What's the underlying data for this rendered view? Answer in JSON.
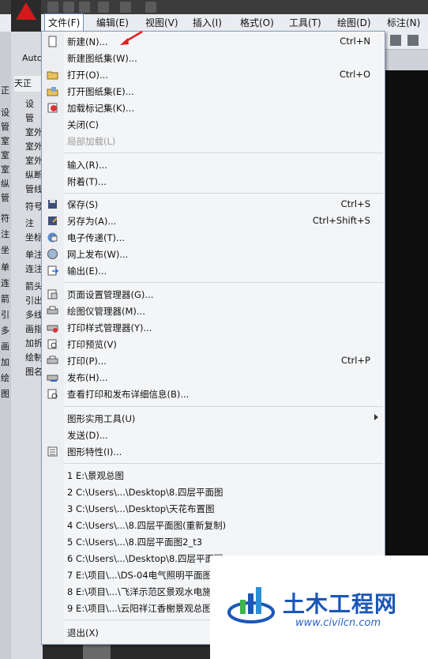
{
  "menubar": {
    "items": [
      {
        "label": "文件(F)"
      },
      {
        "label": "编辑(E)"
      },
      {
        "label": "视图(V)"
      },
      {
        "label": "插入(I)"
      },
      {
        "label": "格式(O)"
      },
      {
        "label": "工具(T)"
      },
      {
        "label": "绘图(D)"
      },
      {
        "label": "标注(N)"
      }
    ]
  },
  "left_panel": {
    "tab_label": "天正",
    "items": [
      "设",
      "管",
      "室外",
      "室外",
      "室外",
      "纵断",
      "管线",
      "符号",
      "注",
      "坐标",
      "单注",
      "连注",
      "箭头",
      "引出",
      "多线",
      "画指",
      "加折",
      "绘制",
      "图名"
    ],
    "strip_chars": [
      "正",
      "设",
      "管",
      "室",
      "室",
      "室",
      "纵",
      "管",
      "符",
      "注",
      "坐",
      "单",
      "连",
      "箭",
      "引",
      "多",
      "画",
      "加",
      "绘",
      "图"
    ]
  },
  "toolbar_right": {
    "label": "Autc"
  },
  "file_menu": {
    "items": [
      {
        "label": "新建(N)...",
        "shortcut": "Ctrl+N",
        "icon": "new-file-icon"
      },
      {
        "label": "新建图纸集(W)...",
        "shortcut": "",
        "icon": ""
      },
      {
        "label": "打开(O)...",
        "shortcut": "Ctrl+O",
        "icon": "open-folder-icon"
      },
      {
        "label": "打开图纸集(E)...",
        "shortcut": "",
        "icon": "open-sheetset-icon"
      },
      {
        "label": "加载标记集(K)...",
        "shortcut": "",
        "icon": "markup-icon"
      },
      {
        "label": "关闭(C)",
        "shortcut": "",
        "icon": ""
      },
      {
        "label": "局部加载(L)",
        "shortcut": "",
        "icon": "",
        "disabled": true
      },
      {
        "label": "输入(R)...",
        "shortcut": "",
        "icon": ""
      },
      {
        "label": "附着(T)...",
        "shortcut": "",
        "icon": ""
      },
      {
        "label": "保存(S)",
        "shortcut": "Ctrl+S",
        "icon": "save-icon"
      },
      {
        "label": "另存为(A)...",
        "shortcut": "Ctrl+Shift+S",
        "icon": "save-as-icon"
      },
      {
        "label": "电子传递(T)...",
        "shortcut": "",
        "icon": "etransmit-icon"
      },
      {
        "label": "网上发布(W)...",
        "shortcut": "",
        "icon": "publish-web-icon"
      },
      {
        "label": "输出(E)...",
        "shortcut": "",
        "icon": "export-icon"
      },
      {
        "label": "页面设置管理器(G)...",
        "shortcut": "",
        "icon": "page-setup-icon"
      },
      {
        "label": "绘图仪管理器(M)...",
        "shortcut": "",
        "icon": "plotter-icon"
      },
      {
        "label": "打印样式管理器(Y)...",
        "shortcut": "",
        "icon": "plot-style-icon"
      },
      {
        "label": "打印预览(V)",
        "shortcut": "",
        "icon": "preview-icon"
      },
      {
        "label": "打印(P)...",
        "shortcut": "Ctrl+P",
        "icon": "print-icon"
      },
      {
        "label": "发布(H)...",
        "shortcut": "",
        "icon": "publish-icon"
      },
      {
        "label": "查看打印和发布详细信息(B)...",
        "shortcut": "",
        "icon": "details-icon"
      },
      {
        "label": "图形实用工具(U)",
        "shortcut": "",
        "icon": "",
        "submenu": true
      },
      {
        "label": "发送(D)...",
        "shortcut": "",
        "icon": ""
      },
      {
        "label": "图形特性(I)...",
        "shortcut": "",
        "icon": "properties-icon"
      },
      {
        "label": "1 E:\\景观总图",
        "shortcut": "",
        "icon": ""
      },
      {
        "label": "2 C:\\Users\\...\\Desktop\\8.四层平面图",
        "shortcut": "",
        "icon": ""
      },
      {
        "label": "3 C:\\Users\\...\\Desktop\\天花布置图",
        "shortcut": "",
        "icon": ""
      },
      {
        "label": "4 C:\\Users\\...\\8.四层平面图(重新复制)",
        "shortcut": "",
        "icon": ""
      },
      {
        "label": "5 C:\\Users\\...\\8.四层平面图2_t3",
        "shortcut": "",
        "icon": ""
      },
      {
        "label": "6 C:\\Users\\...\\Desktop\\8.四层平面图",
        "shortcut": "",
        "icon": ""
      },
      {
        "label": "7 E:\\项目\\...\\DS-04电气照明平面图",
        "shortcut": "",
        "icon": ""
      },
      {
        "label": "8 E:\\项目\\...\\飞洋示范区景观水电施",
        "shortcut": "",
        "icon": ""
      },
      {
        "label": "9 E:\\项目\\...\\云阳祥江香榭景观总图",
        "shortcut": "",
        "icon": ""
      },
      {
        "label": "退出(X)",
        "shortcut": "",
        "icon": ""
      }
    ]
  },
  "watermark": {
    "title": "土木工程网",
    "url": "www.civilcn.com"
  },
  "colors": {
    "accent_red": "#d21a1a",
    "watermark_blue": "#1b57b8"
  }
}
